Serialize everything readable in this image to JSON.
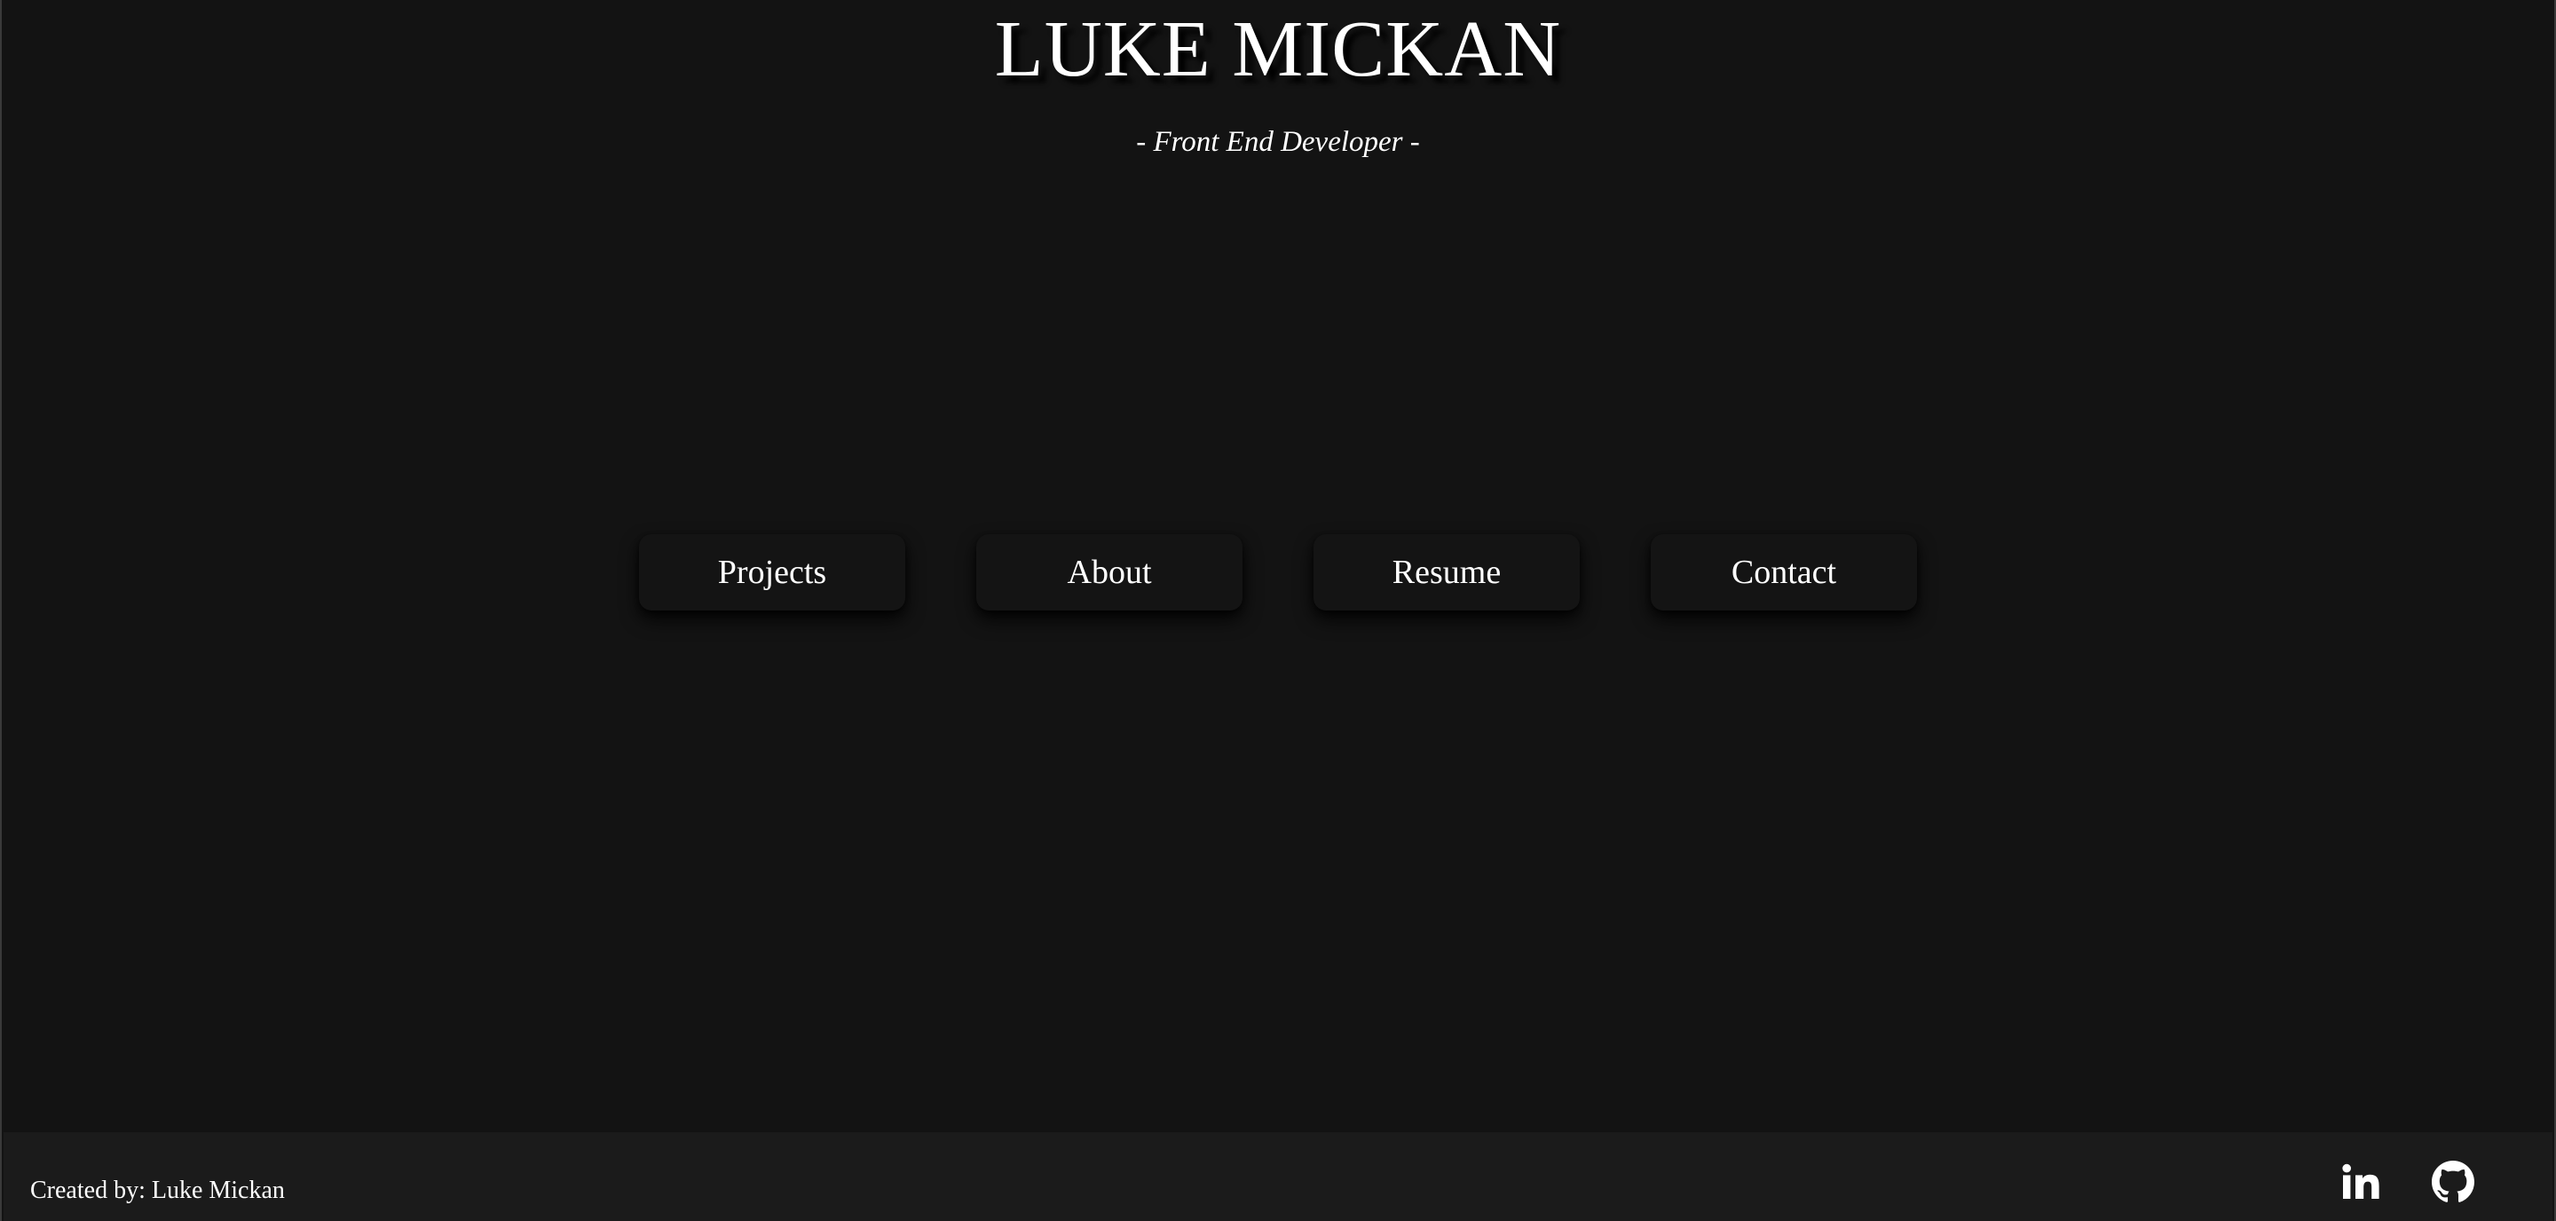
{
  "header": {
    "title": "LUKE MICKAN",
    "subtitle": "- Front End Developer -"
  },
  "nav": {
    "items": [
      {
        "label": "Projects"
      },
      {
        "label": "About"
      },
      {
        "label": "Resume"
      },
      {
        "label": "Contact"
      }
    ]
  },
  "footer": {
    "credit": "Created by: Luke Mickan",
    "social": [
      {
        "icon": "linkedin-icon"
      },
      {
        "icon": "github-icon"
      }
    ]
  },
  "colors": {
    "background": "#131313",
    "footer_background": "#1b1b1b",
    "text": "#ffffff"
  }
}
